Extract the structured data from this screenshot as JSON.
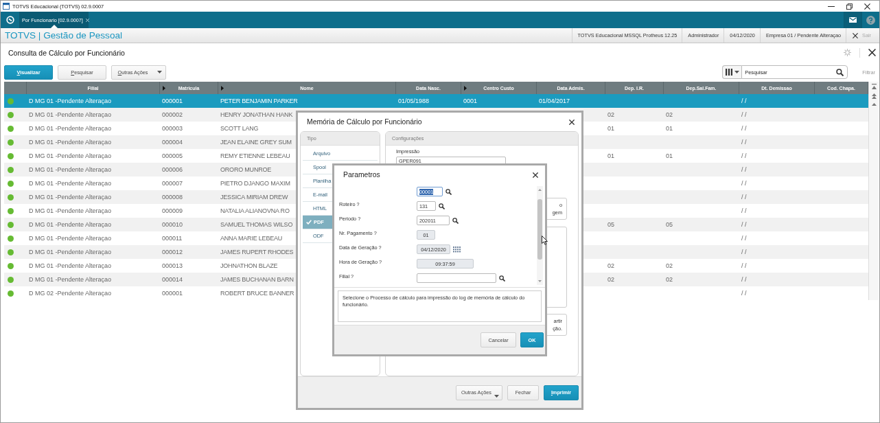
{
  "window": {
    "title": "TOTVS Educacional (TOTVS) 02.9.0007"
  },
  "tabs": [
    {
      "label": "Por Funcionario [02.9.0007]",
      "selected": true
    }
  ],
  "app_bar": {
    "title": "TOTVS | Gestão de Pessoal",
    "info": [
      "TOTVS Educacional MSSQL Protheus 12.25",
      "Administrador",
      "04/12/2020",
      "Empresa 01 / Pendente Alteraçao"
    ],
    "exit": {
      "label": "Sair",
      "disabled": true
    }
  },
  "page": {
    "title": "Consulta de Cálculo por Funcionário"
  },
  "toolbar": {
    "buttons": [
      {
        "label": "Visualizar",
        "kind": "primary",
        "mnemonic": true
      },
      {
        "label": "Pesquisar",
        "kind": "plain",
        "mnemonic": true
      },
      {
        "label": "Outras Ações",
        "kind": "menu",
        "mnemonic": true
      }
    ],
    "search": {
      "placeholder": "Pesquisar"
    },
    "filter": {
      "label": "Filtrar",
      "disabled": true
    }
  },
  "table": {
    "columns": [
      {
        "label": "Filial",
        "marker": false
      },
      {
        "label": "Matricula",
        "marker": true
      },
      {
        "label": "Nome",
        "marker": true
      },
      {
        "label": "Data Nasc.",
        "marker": false
      },
      {
        "label": "Centro Custo",
        "marker": true
      },
      {
        "label": "Data Admis.",
        "marker": false
      },
      {
        "label": "Dep. I.R.",
        "marker": false
      },
      {
        "label": "Dep.Sal.Fam.",
        "marker": false
      },
      {
        "label": "Dt. Demissao",
        "marker": false
      },
      {
        "label": "Cod. Chapa.",
        "marker": false
      }
    ],
    "rows": [
      {
        "color": "#66bb33",
        "selected": true,
        "filial": "D MG 01 -Pendente Alteraçao",
        "matricula": "000001",
        "nome": "PETER BENJAMIN PARKER",
        "data_nasc": "01/05/1988",
        "centro_custo": "0001",
        "data_admis": "01/04/2017",
        "dt_demissao": "/ /"
      },
      {
        "color": "#66bb33",
        "selected": false,
        "filial": "D MG 01 -Pendente Alteraçao",
        "matricula": "000002",
        "nome": "HENRY JONATHAN HANK",
        "dep_ir": "02",
        "dep_sal_fam": "02",
        "dt_demissao": "/ /"
      },
      {
        "color": "#66bb33",
        "selected": false,
        "filial": "D MG 01 -Pendente Alteraçao",
        "matricula": "000003",
        "nome": "SCOTT LANG",
        "dep_ir": "01",
        "dep_sal_fam": "01",
        "dt_demissao": "/ /"
      },
      {
        "color": "#66bb33",
        "selected": false,
        "filial": "D MG 01 -Pendente Alteraçao",
        "matricula": "000004",
        "nome": "JEAN ELAINE GREY SUM",
        "dt_demissao": "/ /"
      },
      {
        "color": "#66bb33",
        "selected": false,
        "filial": "D MG 01 -Pendente Alteraçao",
        "matricula": "000005",
        "nome": "REMY ETIENNE LEBEAU",
        "dep_ir": "01",
        "dep_sal_fam": "01",
        "dt_demissao": "/ /"
      },
      {
        "color": "#66bb33",
        "selected": false,
        "filial": "D MG 01 -Pendente Alteraçao",
        "matricula": "000006",
        "nome": "ORORO MUNROE",
        "dt_demissao": "/ /"
      },
      {
        "color": "#66bb33",
        "selected": false,
        "filial": "D MG 01 -Pendente Alteraçao",
        "matricula": "000007",
        "nome": "PIETRO DJANGO MAXIM",
        "dt_demissao": "/ /"
      },
      {
        "color": "#66bb33",
        "selected": false,
        "filial": "D MG 01 -Pendente Alteraçao",
        "matricula": "000008",
        "nome": "JESSICA MIRIAM DREW",
        "dt_demissao": "/ /"
      },
      {
        "color": "#66bb33",
        "selected": false,
        "filial": "D MG 01 -Pendente Alteraçao",
        "matricula": "000009",
        "nome": "NATALIA ALIANOVNA RO",
        "dt_demissao": "/ /"
      },
      {
        "color": "#66bb33",
        "selected": false,
        "filial": "D MG 01 -Pendente Alteraçao",
        "matricula": "000010",
        "nome": "SAMUEL THOMAS WILSO",
        "dep_ir": "05",
        "dep_sal_fam": "05",
        "dt_demissao": "/ /"
      },
      {
        "color": "#66bb33",
        "selected": false,
        "filial": "D MG 01 -Pendente Alteraçao",
        "matricula": "000011",
        "nome": "ANNA MARIE LEBEAU",
        "dt_demissao": "/ /"
      },
      {
        "color": "#66bb33",
        "selected": false,
        "filial": "D MG 01 -Pendente Alteraçao",
        "matricula": "000012",
        "nome": "JAMES RUPERT RHODES",
        "dt_demissao": "/ /"
      },
      {
        "color": "#66bb33",
        "selected": false,
        "filial": "D MG 01 -Pendente Alteraçao",
        "matricula": "000013",
        "nome": "JOHNATHON BLAZE",
        "dep_ir": "02",
        "dep_sal_fam": "02",
        "dt_demissao": "/ /"
      },
      {
        "color": "#66bb33",
        "selected": false,
        "filial": "D MG 01 -Pendente Alteraçao",
        "matricula": "000014",
        "nome": "JAMES BUCHANAN BARN",
        "dep_ir": "02",
        "dep_sal_fam": "02",
        "dt_demissao": "/ /"
      },
      {
        "color": "#66bb33",
        "selected": false,
        "filial": "D MG 02 -Pendente Alteraçao",
        "matricula": "000001",
        "nome": "ROBERT BRUCE BANNER",
        "dt_demissao": "/ /"
      }
    ]
  },
  "dialog": {
    "title": "Memória de Cálculo por Funcionário",
    "type_panel": {
      "title": "Tipo",
      "items": [
        {
          "label": "Arquivo",
          "selected": false
        },
        {
          "label": "Spool",
          "selected": false
        },
        {
          "label": "Planilha",
          "selected": false
        },
        {
          "label": "E-mail",
          "selected": false
        },
        {
          "label": "HTML",
          "selected": false
        },
        {
          "label": "PDF",
          "selected": true
        },
        {
          "label": "ODF",
          "selected": false
        }
      ]
    },
    "config_panel": {
      "title": "Configurações",
      "print_label": "Impressão",
      "print_value": "GPER091",
      "option_boxes": [
        {
          "kind": "text",
          "lines": [
            "o",
            "gem"
          ]
        },
        {
          "kind": "frame"
        },
        {
          "kind": "text",
          "lines": [
            "artir",
            "ção."
          ]
        }
      ]
    },
    "buttons": [
      {
        "label": "Outras Ações",
        "kind": "menu",
        "mnemonic": false
      },
      {
        "label": "Fechar",
        "kind": "plain",
        "mnemonic": false
      },
      {
        "label": "Imprimir",
        "kind": "primary",
        "mnemonic": true
      }
    ]
  },
  "parameters_dialog": {
    "title": "Parametros",
    "fields": [
      {
        "value": "00001",
        "kind": "lookup",
        "disabled": false,
        "highlighted": true
      },
      {
        "label": "Roteiro ?",
        "value": "131",
        "kind": "lookup",
        "disabled": false,
        "highlighted": false
      },
      {
        "label": "Periodo ?",
        "value": "202011",
        "kind": "lookup",
        "disabled": false,
        "highlighted": false
      },
      {
        "label": "Nr. Pagamento ?",
        "value": "01",
        "kind": "text",
        "disabled": true,
        "highlighted": false
      },
      {
        "label": "Data de Geração ?",
        "value": "04/12/2020",
        "kind": "date",
        "disabled": true,
        "highlighted": false
      },
      {
        "label": "Hora de Geração ?",
        "value": "09:37:59",
        "kind": "text",
        "disabled": true,
        "highlighted": false
      },
      {
        "label": "Filial ?",
        "kind": "lookup",
        "disabled": false,
        "highlighted": false
      }
    ],
    "help": "Selecione o Processo de cálculo para impressão do log de memória de cálculo do funcionário.",
    "buttons": [
      {
        "label": "Cancelar",
        "kind": "plain",
        "mnemonic": false
      },
      {
        "label": "OK",
        "kind": "primary",
        "mnemonic": false
      }
    ]
  }
}
